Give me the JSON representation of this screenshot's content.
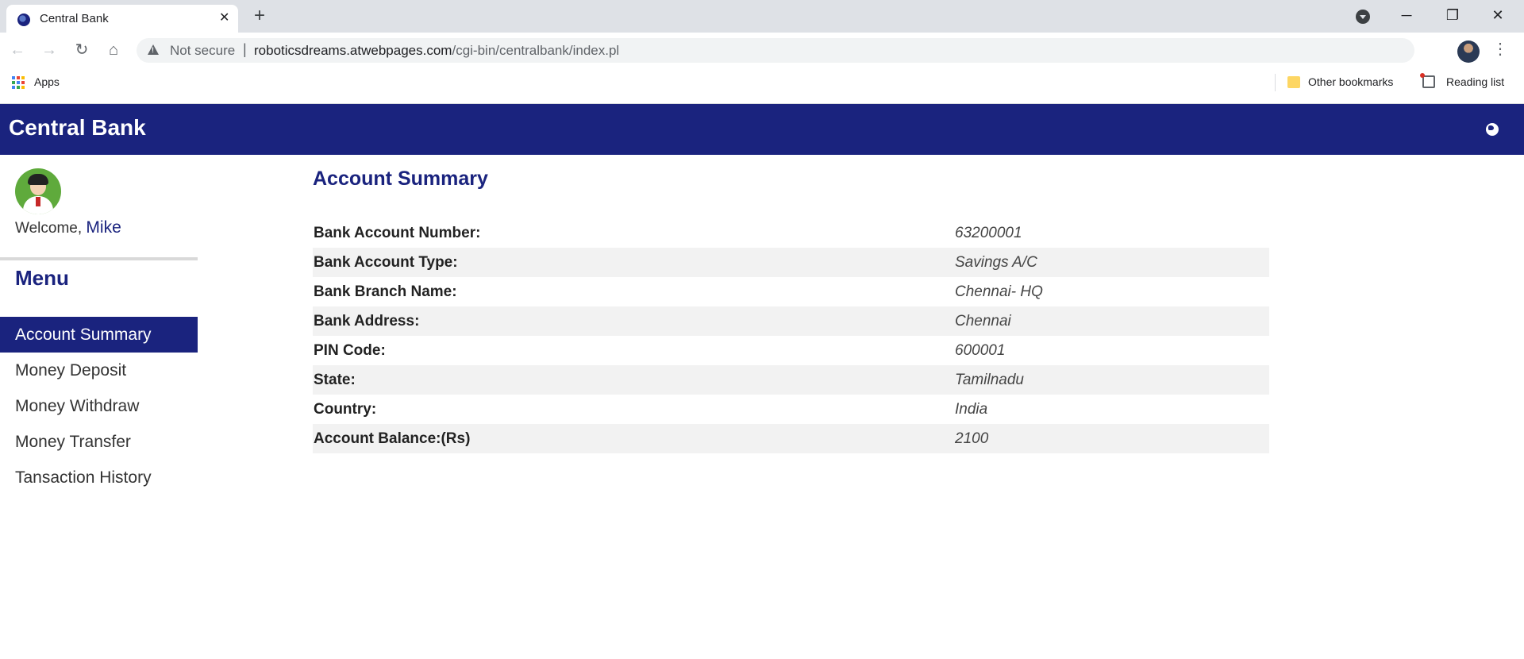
{
  "browser": {
    "tab_title": "Central Bank",
    "security_label": "Not secure",
    "url_host": "roboticsdreams.atwebpages.com",
    "url_path": "/cgi-bin/centralbank/index.pl",
    "bookmarks": {
      "apps": "Apps",
      "other": "Other bookmarks",
      "reading_list": "Reading list"
    }
  },
  "app": {
    "brand": "Central Bank",
    "accent_color": "#1a237e"
  },
  "sidebar": {
    "welcome": "Welcome,",
    "username": "Mike",
    "menu_title": "Menu",
    "items": [
      {
        "label": "Account Summary",
        "active": true
      },
      {
        "label": "Money Deposit",
        "active": false
      },
      {
        "label": "Money Withdraw",
        "active": false
      },
      {
        "label": "Money Transfer",
        "active": false
      },
      {
        "label": "Tansaction History",
        "active": false
      }
    ]
  },
  "main": {
    "title": "Account Summary",
    "rows": [
      {
        "label": "Bank Account Number:",
        "value": "63200001"
      },
      {
        "label": "Bank Account Type:",
        "value": "Savings A/C"
      },
      {
        "label": "Bank Branch Name:",
        "value": "Chennai- HQ"
      },
      {
        "label": "Bank Address:",
        "value": "Chennai"
      },
      {
        "label": "PIN Code:",
        "value": "600001"
      },
      {
        "label": "State:",
        "value": "Tamilnadu"
      },
      {
        "label": "Country:",
        "value": "India"
      },
      {
        "label": "Account Balance:(Rs)",
        "value": "2100"
      }
    ]
  }
}
